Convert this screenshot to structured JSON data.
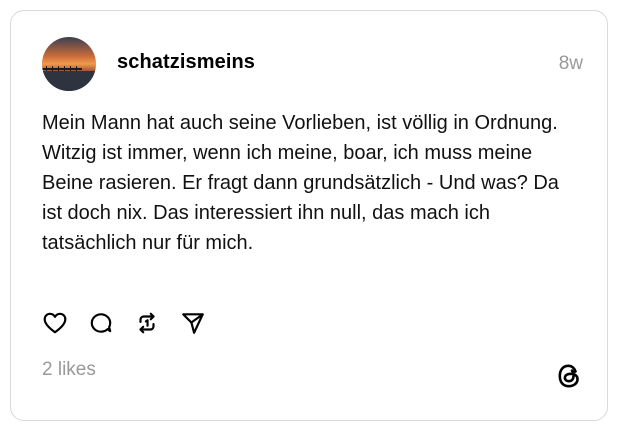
{
  "post": {
    "username": "schatzismeins",
    "timestamp": "8w",
    "text": "Mein Mann hat auch seine Vorlieben, ist völlig in Ordnung. Witzig ist immer, wenn ich meine, boar, ich muss meine Beine rasieren. Er fragt dann grundsätzlich - Und was? Da ist doch nix. Das interessiert ihn null, das mach ich tatsächlich nur für mich.",
    "likes": "2 likes"
  },
  "icons": {
    "like": "heart-icon",
    "reply": "comment-icon",
    "repost": "repost-icon",
    "share": "send-icon",
    "brand": "threads-logo-icon"
  },
  "colors": {
    "text": "#111111",
    "muted": "#999999",
    "border": "#d9d9d9"
  }
}
